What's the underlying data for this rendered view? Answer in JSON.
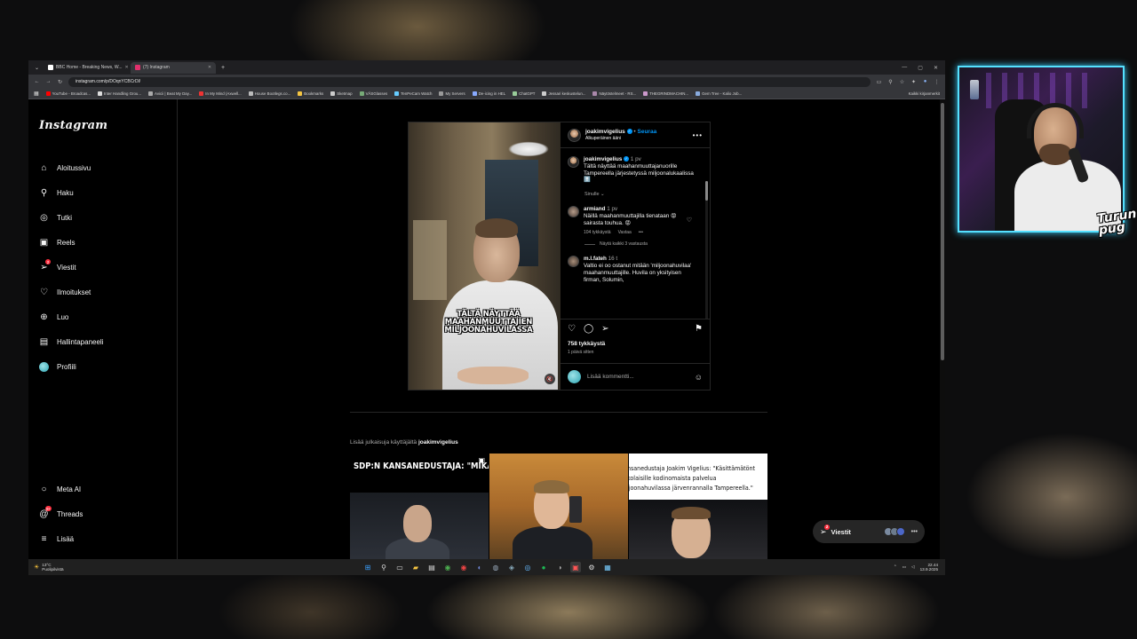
{
  "browser": {
    "tabs": [
      {
        "label": "BBC Home - Breaking News, W...",
        "color": "#ffffff"
      },
      {
        "label": "(7) Instagram",
        "color": "#e1306c"
      }
    ],
    "url": "instagram.com/p/DOqnYCBCrDl/",
    "bookmarks": [
      "YouTube - Broadcas...",
      "Inter Handling Grou...",
      "Avicii | Beat My Day...",
      "In My Mind (Axwell...",
      "House Bootlegs.co...",
      "Bookmarks",
      "Sketmap",
      "VÄSGlasses",
      "TenPeCam Watch",
      "My Servers",
      "De-icing in HEL",
      "ChatGPT",
      "Jessari keskustelun...",
      "Näytöstelmeet - RS...",
      "THEGRINDMACHIN...",
      "Gem Tree - Kalio Job..."
    ],
    "bookmarks_right": "Kaikki kirjanmerkit"
  },
  "instagram": {
    "logo": "Instagram",
    "nav": [
      {
        "label": "Aloitussivu",
        "icon": "home-icon",
        "glyph": "⌂"
      },
      {
        "label": "Haku",
        "icon": "search-icon",
        "glyph": "⚲"
      },
      {
        "label": "Tutki",
        "icon": "compass-icon",
        "glyph": "◎"
      },
      {
        "label": "Reels",
        "icon": "reels-icon",
        "glyph": "▣"
      },
      {
        "label": "Viestit",
        "icon": "messenger-icon",
        "glyph": "➢",
        "badge": "2"
      },
      {
        "label": "Ilmoitukset",
        "icon": "heart-icon",
        "glyph": "♡"
      },
      {
        "label": "Luo",
        "icon": "plus-icon",
        "glyph": "⊕"
      },
      {
        "label": "Hallintapaneeli",
        "icon": "dashboard-icon",
        "glyph": "▤"
      },
      {
        "label": "Profiili",
        "icon": "profile-icon",
        "glyph": ""
      }
    ],
    "nav_bottom": [
      {
        "label": "Meta AI",
        "icon": "meta-ai-icon",
        "glyph": "○"
      },
      {
        "label": "Threads",
        "icon": "threads-icon",
        "glyph": "@",
        "badge": "9+"
      },
      {
        "label": "Lisää",
        "icon": "menu-icon",
        "glyph": "≡"
      }
    ],
    "post": {
      "video_caption": "TÄLTÄ NÄYTTÄÄ MAAHANMUUTTAJIEN MILJOONAHUVILASSA",
      "author": "joakimvigelius",
      "follow": "Seuraa",
      "audio": "Alkuperäinen ääni",
      "caption_age": "1 pv",
      "caption": "Tältä näyttää maahanmuuttajanuorille Tampereella järjestetyssä miljoonalukaalissa ⬆️",
      "sinulle": "Sinulle",
      "comments": [
        {
          "user": "armiand",
          "age": "1 pv",
          "text": "Näillä maahanmuuttajilla tienataan 😡 sairasta touhua. 😡",
          "likes": "104 tykkäystä",
          "reply": "Vastaa",
          "replies": "Näytä kaikki 3 vastausta"
        },
        {
          "user": "m.l.fateh",
          "age": "16 t",
          "text": "Valtio ei oo ostanut mitään 'miljoonahuvilaa' maahanmuuttajille. Huvila on yksityisen firman, Solumin,"
        }
      ],
      "likes": "758 tykkäystä",
      "posted": "1 päivä sitten",
      "add_comment_placeholder": "Lisää kommentti..."
    },
    "more_posts": {
      "prefix": "Lisää julkaisuja käyttäjältä",
      "user": "joakimvigelius",
      "items": [
        {
          "text": "SDP:N KANSANEDUSTAJA: \"MIKÄ ALIJÄÄMÄ? MIKÄ VELKAONGELMA?\""
        },
        {
          "text": ""
        },
        {
          "text": "nsanedustaja Joakim Vigelius: \"Käsittämätönt kolaisille kodinomaista palvelua ljoonahuvilassa järvenrannalla Tampereella.\""
        }
      ]
    },
    "messages_button": {
      "label": "Viestit",
      "badge": "2"
    }
  },
  "taskbar": {
    "weather_temp": "13°C",
    "weather_desc": "Puolipilvistä",
    "time": "22.44",
    "date": "13.9.2025"
  },
  "overlay": {
    "logo_text": "Turun pug"
  }
}
